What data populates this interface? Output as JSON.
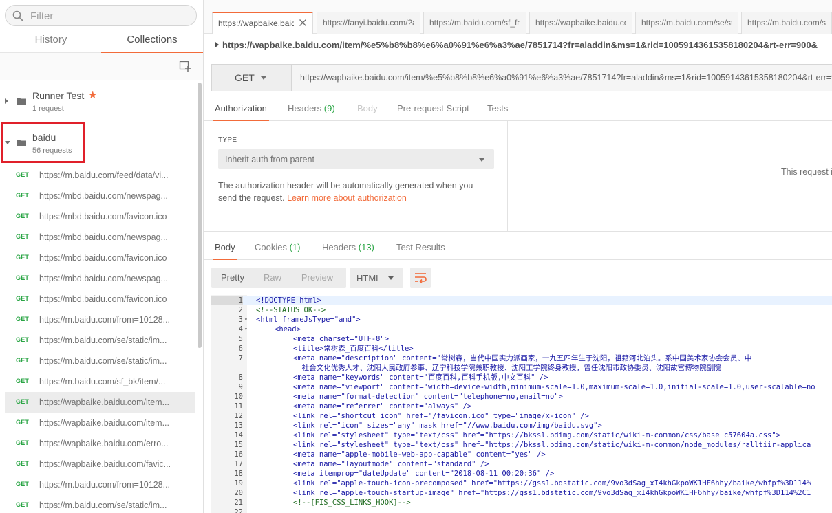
{
  "sidebar": {
    "filter_placeholder": "Filter",
    "tabs": [
      {
        "label": "History",
        "active": false
      },
      {
        "label": "Collections",
        "active": true
      }
    ],
    "collections": [
      {
        "name": "Runner Test",
        "count": "1 request",
        "starred": true,
        "expanded": false
      },
      {
        "name": "baidu",
        "count": "56 requests",
        "starred": false,
        "expanded": true
      }
    ],
    "requests": [
      {
        "method": "GET",
        "url": "https://m.baidu.com/feed/data/vi..."
      },
      {
        "method": "GET",
        "url": "https://mbd.baidu.com/newspag..."
      },
      {
        "method": "GET",
        "url": "https://mbd.baidu.com/favicon.ico"
      },
      {
        "method": "GET",
        "url": "https://mbd.baidu.com/newspag..."
      },
      {
        "method": "GET",
        "url": "https://mbd.baidu.com/favicon.ico"
      },
      {
        "method": "GET",
        "url": "https://mbd.baidu.com/newspag..."
      },
      {
        "method": "GET",
        "url": "https://mbd.baidu.com/favicon.ico"
      },
      {
        "method": "GET",
        "url": "https://m.baidu.com/from=10128..."
      },
      {
        "method": "GET",
        "url": "https://m.baidu.com/se/static/im..."
      },
      {
        "method": "GET",
        "url": "https://m.baidu.com/se/static/im..."
      },
      {
        "method": "GET",
        "url": "https://m.baidu.com/sf_bk/item/..."
      },
      {
        "method": "GET",
        "url": "https://wapbaike.baidu.com/item...",
        "selected": true
      },
      {
        "method": "GET",
        "url": "https://wapbaike.baidu.com/item..."
      },
      {
        "method": "GET",
        "url": "https://wapbaike.baidu.com/erro..."
      },
      {
        "method": "GET",
        "url": "https://wapbaike.baidu.com/favic..."
      },
      {
        "method": "GET",
        "url": "https://m.baidu.com/from=10128..."
      },
      {
        "method": "GET",
        "url": "https://m.baidu.com/se/static/im..."
      }
    ]
  },
  "tabs": [
    {
      "label": "https://wapbaike.baidu",
      "active": true
    },
    {
      "label": "https://fanyi.baidu.com/?aldtype"
    },
    {
      "label": "https://m.baidu.com/sf_fanyi"
    },
    {
      "label": "https://wapbaike.baidu.com"
    },
    {
      "label": "https://m.baidu.com/se/static"
    },
    {
      "label": "https://m.baidu.com/sf_bk"
    }
  ],
  "request": {
    "title_url": "https://wapbaike.baidu.com/item/%e5%b8%b8%e6%a0%91%e6%a3%ae/7851714?fr=aladdin&ms=1&rid=10059143615358180204&rt-err=900&",
    "method": "GET",
    "url": "https://wapbaike.baidu.com/item/%e5%b8%b8%e6%a0%91%e6%a3%ae/7851714?fr=aladdin&ms=1&rid=10059143615358180204&rt-err=900",
    "tabs": [
      {
        "label": "Authorization",
        "active": true
      },
      {
        "label": "Headers",
        "count": "(9)"
      },
      {
        "label": "Body",
        "disabled": true
      },
      {
        "label": "Pre-request Script"
      },
      {
        "label": "Tests"
      }
    ]
  },
  "auth": {
    "type_label": "TYPE",
    "type_value": "Inherit auth from parent",
    "description": "The authorization header will be automatically generated when you send the request.",
    "link_text": "Learn more about authorization",
    "right_text": "This request i"
  },
  "response": {
    "tabs": [
      {
        "label": "Body",
        "active": true
      },
      {
        "label": "Cookies",
        "count": "(1)"
      },
      {
        "label": "Headers",
        "count": "(13)"
      },
      {
        "label": "Test Results"
      }
    ],
    "formats": [
      "Pretty",
      "Raw",
      "Preview"
    ],
    "active_format": "Pretty",
    "language": "HTML",
    "lines": [
      {
        "n": "1",
        "fold": "",
        "text": "<!DOCTYPE html>",
        "indent": 0
      },
      {
        "n": "2",
        "fold": "",
        "text": "<!--STATUS OK-->",
        "indent": 0,
        "comment": true
      },
      {
        "n": "3",
        "fold": "▾",
        "text": "<html frameJsType=\"amd\">",
        "indent": 0
      },
      {
        "n": "4",
        "fold": "▾",
        "text": "<head>",
        "indent": 1
      },
      {
        "n": "5",
        "fold": "",
        "text": "<meta charset=\"UTF-8\">",
        "indent": 2
      },
      {
        "n": "6",
        "fold": "",
        "text": "<title>常树森_百度百科</title>",
        "indent": 2
      },
      {
        "n": "7",
        "fold": "",
        "text": "<meta name=\"description\" content=\"常树森，当代中国实力派画家，一九五四年生于沈阳，祖籍河北泊头。系中国美术家协会会员、中",
        "indent": 2
      },
      {
        "n": "",
        "fold": "",
        "text": "  社会文化优秀人才、沈阳人民政府参事、辽宁科技学院兼职教授、沈阳工学院终身教授，曾任沈阳市政协委员、沈阳故宫博物院副院",
        "indent": 2
      },
      {
        "n": "8",
        "fold": "",
        "text": "<meta name=\"keywords\" content=\"百度百科,百科手机版,中文百科\" />",
        "indent": 2
      },
      {
        "n": "9",
        "fold": "",
        "text": "<meta name=\"viewport\" content=\"width=device-width,minimum-scale=1.0,maximum-scale=1.0,initial-scale=1.0,user-scalable=no",
        "indent": 2
      },
      {
        "n": "10",
        "fold": "",
        "text": "<meta name=\"format-detection\" content=\"telephone=no,email=no\">",
        "indent": 2
      },
      {
        "n": "11",
        "fold": "",
        "text": "<meta name=\"referrer\" content=\"always\" />",
        "indent": 2
      },
      {
        "n": "12",
        "fold": "",
        "text": "<link rel=\"shortcut icon\" href=\"/favicon.ico\" type=\"image/x-icon\" />",
        "indent": 2
      },
      {
        "n": "13",
        "fold": "",
        "text": "<link rel=\"icon\" sizes=\"any\" mask href=\"//www.baidu.com/img/baidu.svg\">",
        "indent": 2
      },
      {
        "n": "14",
        "fold": "",
        "text": "<link rel=\"stylesheet\" type=\"text/css\" href=\"https://bkssl.bdimg.com/static/wiki-m-common/css/base_c57604a.css\">",
        "indent": 2
      },
      {
        "n": "15",
        "fold": "",
        "text": "<link rel=\"stylesheet\" type=\"text/css\" href=\"https://bkssl.bdimg.com/static/wiki-m-common/node_modules/ralltiir-applica",
        "indent": 2
      },
      {
        "n": "16",
        "fold": "",
        "text": "<meta name=\"apple-mobile-web-app-capable\" content=\"yes\" />",
        "indent": 2
      },
      {
        "n": "17",
        "fold": "",
        "text": "<meta name=\"layoutmode\" content=\"standard\" />",
        "indent": 2
      },
      {
        "n": "18",
        "fold": "",
        "text": "<meta itemprop=\"dateUpdate\" content=\"2018-08-11 00:20:36\" />",
        "indent": 2
      },
      {
        "n": "19",
        "fold": "",
        "text": "<link rel=\"apple-touch-icon-precomposed\" href=\"https://gss1.bdstatic.com/9vo3dSag_xI4khGkpoWK1HF6hhy/baike/whfpf%3D114%",
        "indent": 2
      },
      {
        "n": "20",
        "fold": "",
        "text": "<link rel=\"apple-touch-startup-image\" href=\"https://gss1.bdstatic.com/9vo3dSag_xI4khGkpoWK1HF6hhy/baike/whfpf%3D114%2C1",
        "indent": 2
      },
      {
        "n": "21",
        "fold": "",
        "text": "<!--[FIS_CSS_LINKS_HOOK]-->",
        "indent": 2,
        "comment": true
      },
      {
        "n": "22",
        "fold": "",
        "text": "",
        "indent": 2
      }
    ]
  },
  "colors": {
    "accent": "#f26b3a",
    "get_method": "#2aa545",
    "highlight_box": "#e0202a"
  }
}
